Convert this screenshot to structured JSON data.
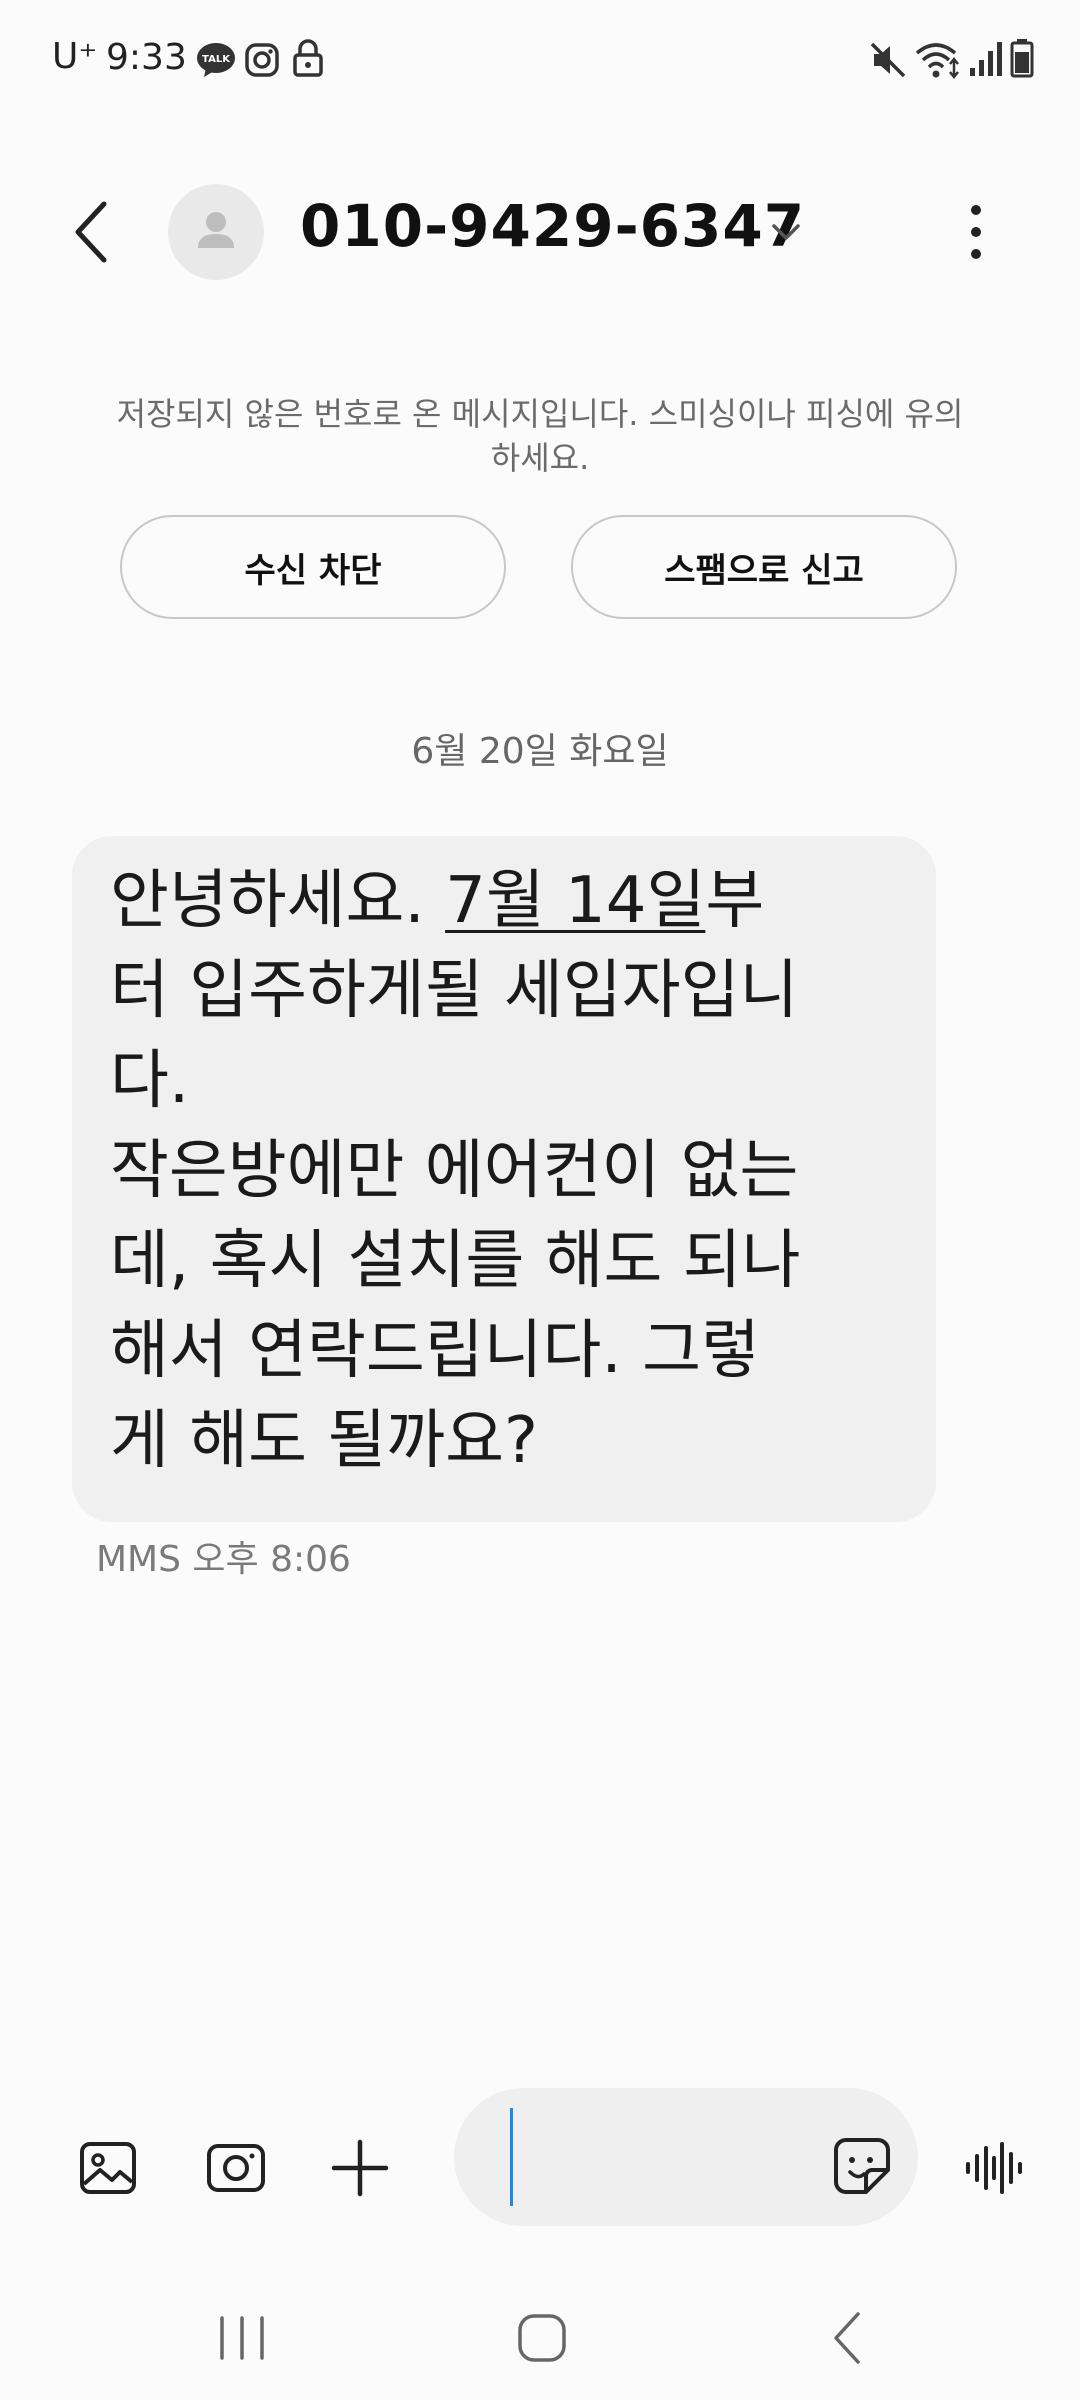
{
  "status_bar": {
    "carrier": "U⁺",
    "time": "9:33",
    "left_icons": [
      "kakaotalk-icon",
      "instagram-icon",
      "lock-icon"
    ],
    "right_icons": [
      "mute-icon",
      "wifi-icon",
      "signal-icon",
      "battery-icon"
    ]
  },
  "header": {
    "contact": "010-9429-6347"
  },
  "warning": {
    "text": "저장되지 않은 번호로 온 메시지입니다. 스미싱이나 피싱에 유의하세요.",
    "block_label": "수신 차단",
    "spam_label": "스팸으로 신고"
  },
  "date_separator": "6월 20일 화요일",
  "message": {
    "lines": [
      {
        "before": "안녕하세요. ",
        "link": "7월 14일",
        "after": "부"
      },
      {
        "text": "터 입주하게될 세입자입니"
      },
      {
        "text": "다."
      },
      {
        "text": "작은방에만 에어컨이 없는"
      },
      {
        "text": "데, 혹시 설치를 해도 되나"
      },
      {
        "text": "해서 연락드립니다. 그렇"
      },
      {
        "text": "게 해도 될까요?"
      }
    ],
    "meta": "MMS 오후 8:06"
  },
  "input_bar": {
    "tools": [
      "gallery-icon",
      "camera-icon",
      "plus-icon"
    ],
    "compose_value": "",
    "sticker_icon": "sticker-icon",
    "voice_icon": "voice-wave-icon"
  },
  "nav_bar": [
    "recent-apps-icon",
    "home-icon",
    "back-nav-icon"
  ],
  "colors": {
    "background": "#fbfbfb",
    "bubble": "#f0f0f0",
    "cursor": "#1e88e5"
  }
}
